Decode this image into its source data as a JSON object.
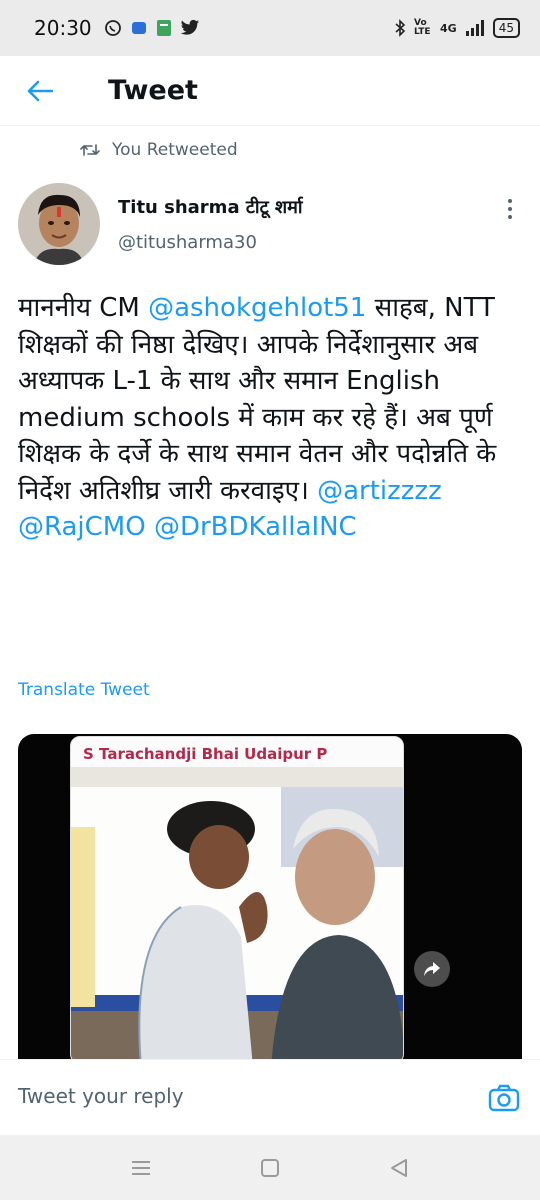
{
  "status_bar": {
    "time": "20:30",
    "network": "4G",
    "volte": "Vo LTE",
    "battery": "45"
  },
  "header": {
    "title": "Tweet"
  },
  "retweet": {
    "label": "You Retweeted"
  },
  "tweet": {
    "author_name": "Titu sharma टीटू शर्मा",
    "author_handle": "@titusharma30",
    "text_parts": [
      "माननीय CM ",
      "@ashokgehlot51",
      " साहब, NTT शिक्षकों की निष्ठा देखिए। आपके निर्देशानुसार अब अध्यापक L-1 के साथ और समान English medium schools में काम कर रहे हैं। अब पूर्ण शिक्षक के दर्जे के साथ समान वेतन और पदोन्नति के निर्देश अतिशीघ्र जारी करवाइए। ",
      "@artizzzz",
      " ",
      "@RajCMO",
      " ",
      "@DrBDKallaINC"
    ],
    "translate_label": "Translate Tweet",
    "media_caption": "S Tarachandji Bhai Udaipur P"
  },
  "reply": {
    "placeholder": "Tweet your reply"
  },
  "colors": {
    "accent": "#1d9bf0",
    "text": "#0f1419",
    "secondary": "#536471"
  }
}
